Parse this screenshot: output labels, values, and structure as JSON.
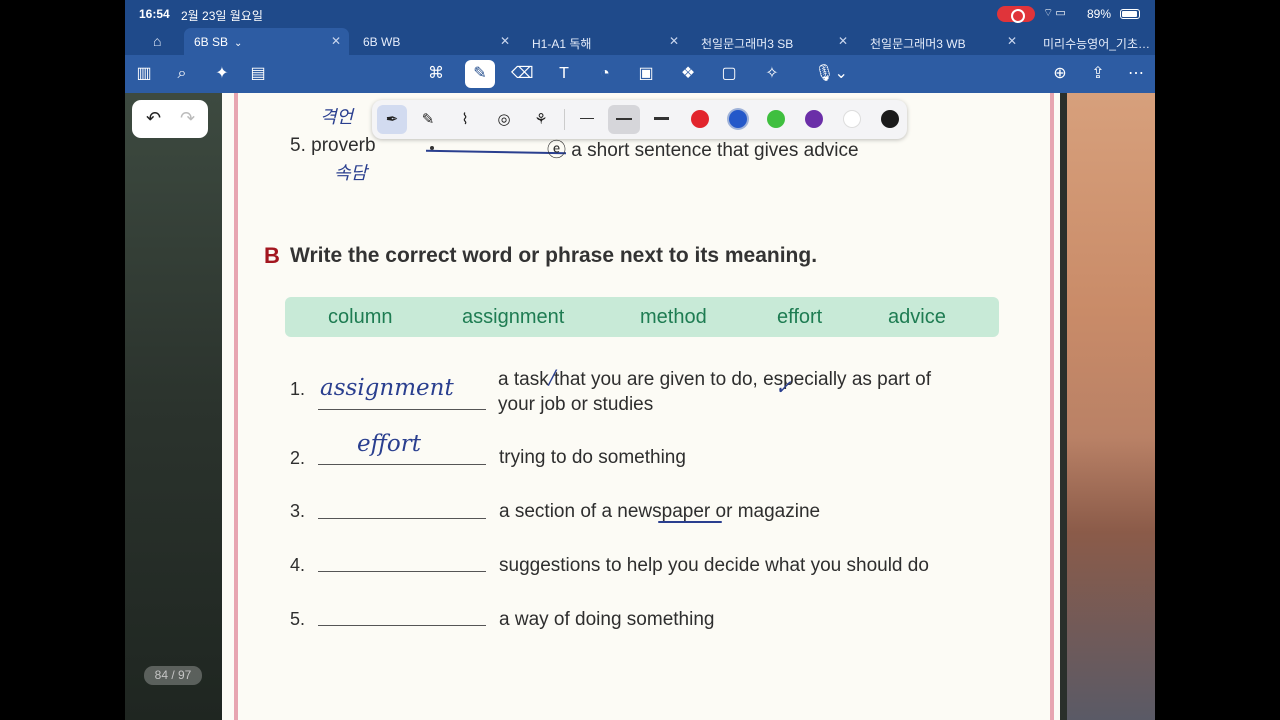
{
  "status_bar": {
    "time": "16:54",
    "date": "2월 23일 월요일",
    "battery": "89%"
  },
  "tabs": [
    {
      "label": "6B SB",
      "active": true
    },
    {
      "label": "6B WB"
    },
    {
      "label": "H1-A1 독해"
    },
    {
      "label": "천일문그래머3 SB"
    },
    {
      "label": "천일문그래머3 WB"
    },
    {
      "label": "미리수능영어_기초…"
    }
  ],
  "page_counter": "84 / 97",
  "exercise_a": {
    "item5_number": "5.",
    "item5_word": "proverb",
    "item5_letter": "ⓔ",
    "item5_definition": "a short sentence that gives advice",
    "handwriting_note1": "격언",
    "handwriting_note2": "속담"
  },
  "exercise_b": {
    "letter": "B",
    "instruction": "Write the correct word or phrase next to its meaning.",
    "word_bank": [
      "column",
      "assignment",
      "method",
      "effort",
      "advice"
    ],
    "items": [
      {
        "number": "1.",
        "answer": "assignment",
        "definition_line1": "a task that you are given to do, especially as part of",
        "definition_line2": "your job or studies"
      },
      {
        "number": "2.",
        "answer": "effort",
        "definition_line1": "trying to do something",
        "definition_line2": ""
      },
      {
        "number": "3.",
        "answer": "",
        "definition_line1": "a section of a newspaper or magazine",
        "definition_line2": ""
      },
      {
        "number": "4.",
        "answer": "",
        "definition_line1": "suggestions to help you decide what you should do",
        "definition_line2": ""
      },
      {
        "number": "5.",
        "answer": "",
        "definition_line1": "a way of doing something",
        "definition_line2": ""
      }
    ]
  },
  "palette_colors": [
    "#e2252d",
    "#2458c9",
    "#3fbf3f",
    "#6b2fa8",
    "#ffffff",
    "#1b1b1b"
  ]
}
